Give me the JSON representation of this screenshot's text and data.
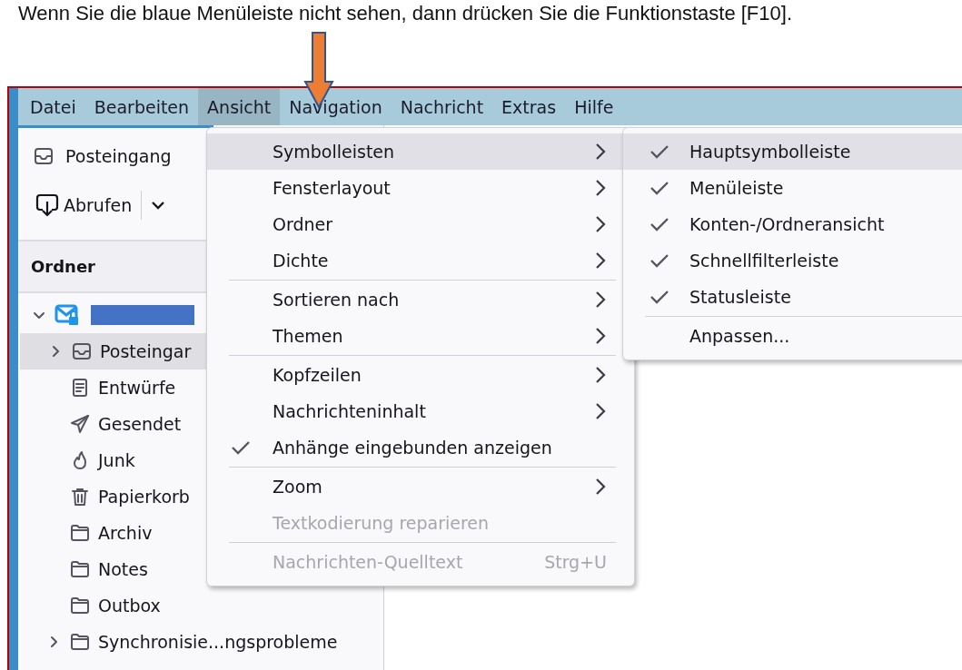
{
  "caption": "Wenn Sie die blaue Menüleiste nicht sehen, dann drücken Sie die Funktionstaste [F10].",
  "menubar": [
    {
      "label": "Datei",
      "selected": false
    },
    {
      "label": "Bearbeiten",
      "selected": false
    },
    {
      "label": "Ansicht",
      "selected": true
    },
    {
      "label": "Navigation",
      "selected": false
    },
    {
      "label": "Nachricht",
      "selected": false
    },
    {
      "label": "Extras",
      "selected": false
    },
    {
      "label": "Hilfe",
      "selected": false
    }
  ],
  "sidebar": {
    "tab": {
      "label": "Posteingang"
    },
    "toolbar": {
      "get_button": "Abrufen"
    },
    "header": "Ordner",
    "tree": [
      {
        "kind": "account",
        "expanded": true,
        "selected": false,
        "children": [
          {
            "kind": "inbox",
            "label": "Posteingar",
            "expanded": false,
            "selected": true
          },
          {
            "kind": "drafts",
            "label": "Entwürfe",
            "selected": false
          },
          {
            "kind": "sent",
            "label": "Gesendet",
            "selected": false
          },
          {
            "kind": "junk",
            "label": "Junk",
            "selected": false
          },
          {
            "kind": "trash",
            "label": "Papierkorb",
            "selected": false
          },
          {
            "kind": "folder",
            "label": "Archiv",
            "selected": false
          },
          {
            "kind": "folder",
            "label": "Notes",
            "selected": false
          },
          {
            "kind": "folder",
            "label": "Outbox",
            "selected": false
          },
          {
            "kind": "folder",
            "label": "Synchronisie...ngsprobleme",
            "expanded": false,
            "selected": false
          }
        ]
      }
    ]
  },
  "view_menu": {
    "groups": [
      [
        {
          "label": "Symbolleisten",
          "submenu": true,
          "selected": true,
          "checked": false,
          "disabled": false
        },
        {
          "label": "Fensterlayout",
          "submenu": true,
          "selected": false,
          "checked": false,
          "disabled": false
        },
        {
          "label": "Ordner",
          "submenu": true,
          "selected": false,
          "checked": false,
          "disabled": false
        },
        {
          "label": "Dichte",
          "submenu": true,
          "selected": false,
          "checked": false,
          "disabled": false
        }
      ],
      [
        {
          "label": "Sortieren nach",
          "submenu": true,
          "selected": false,
          "checked": false,
          "disabled": false
        },
        {
          "label": "Themen",
          "submenu": true,
          "selected": false,
          "checked": false,
          "disabled": false
        }
      ],
      [
        {
          "label": "Kopfzeilen",
          "submenu": true,
          "selected": false,
          "checked": false,
          "disabled": false
        },
        {
          "label": "Nachrichteninhalt",
          "submenu": true,
          "selected": false,
          "checked": false,
          "disabled": false
        },
        {
          "label": "Anhänge eingebunden anzeigen",
          "submenu": false,
          "selected": false,
          "checked": true,
          "disabled": false
        }
      ],
      [
        {
          "label": "Zoom",
          "submenu": true,
          "selected": false,
          "checked": false,
          "disabled": false
        },
        {
          "label": "Textkodierung reparieren",
          "submenu": false,
          "selected": false,
          "checked": false,
          "disabled": true
        }
      ],
      [
        {
          "label": "Nachrichten-Quelltext",
          "shortcut": "Strg+U",
          "submenu": false,
          "selected": false,
          "checked": false,
          "disabled": true
        }
      ]
    ]
  },
  "toolbars_submenu": {
    "groups": [
      [
        {
          "label": "Hauptsymbolleiste",
          "submenu": false,
          "selected": true,
          "checked": true,
          "disabled": false
        },
        {
          "label": "Menüleiste",
          "submenu": false,
          "selected": false,
          "checked": true,
          "disabled": false
        },
        {
          "label": "Konten-/Ordneransicht",
          "submenu": false,
          "selected": false,
          "checked": true,
          "disabled": false
        },
        {
          "label": "Schnellfilterleiste",
          "submenu": false,
          "selected": false,
          "checked": true,
          "disabled": false
        },
        {
          "label": "Statusleiste",
          "submenu": false,
          "selected": false,
          "checked": true,
          "disabled": false
        }
      ],
      [
        {
          "label": "Anpassen...",
          "submenu": false,
          "selected": false,
          "checked": false,
          "disabled": false
        }
      ]
    ]
  }
}
